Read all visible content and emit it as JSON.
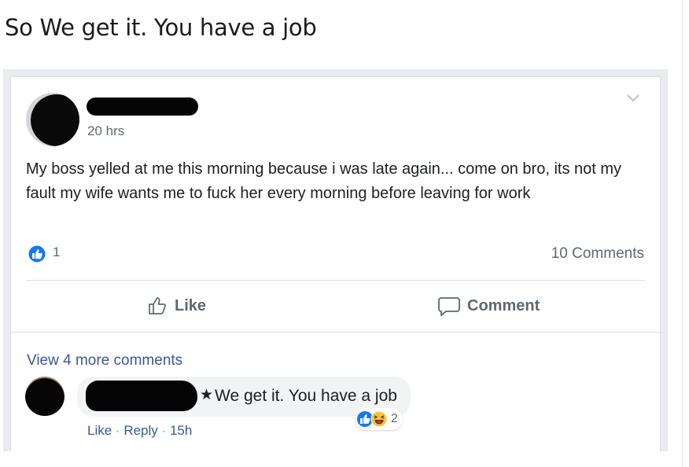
{
  "caption": "So We get it. You have a job",
  "post": {
    "timestamp": "20 hrs",
    "text": "My boss yelled at me this morning because i was late again... come on bro, its not my fault my wife wants me to fuck her every morning before leaving for work",
    "like_count": "1",
    "comment_count": "10 Comments",
    "actions": {
      "like": "Like",
      "comment": "Comment"
    }
  },
  "comments": {
    "view_more": "View 4 more comments",
    "items": [
      {
        "text": "We get it. You have a job",
        "reaction_count": "2",
        "actions": {
          "like": "Like",
          "reply": "Reply",
          "separator": "·",
          "time": "15h"
        }
      }
    ]
  },
  "colors": {
    "link": "#385898",
    "like_blue": "#1877f2",
    "haha_yellow": "#f7c242",
    "secondary_text": "#606770"
  },
  "icons": [
    "chevron-down-icon",
    "like-badge-icon",
    "thumbs-up-icon",
    "comment-bubble-icon",
    "haha-reaction-icon",
    "star-icon"
  ]
}
